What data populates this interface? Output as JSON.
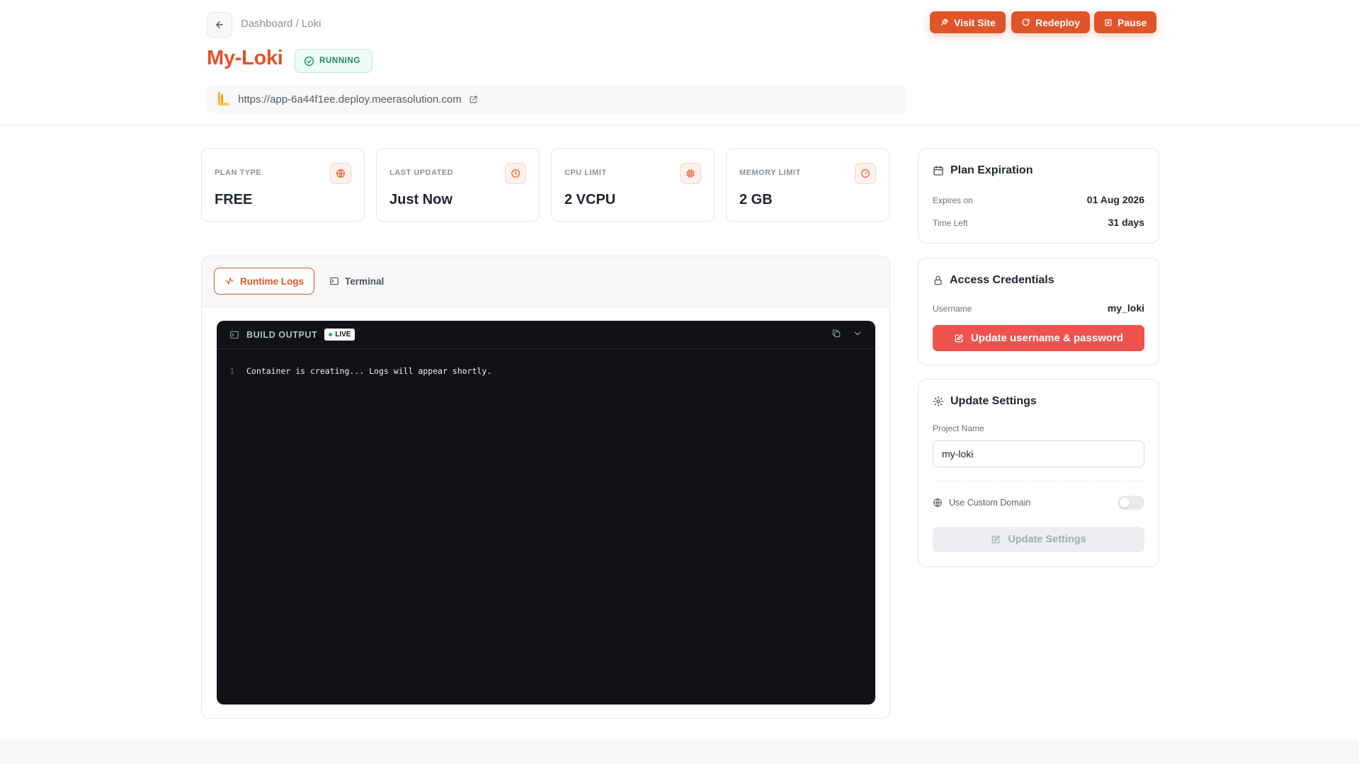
{
  "header": {
    "breadcrumb": "Dashboard / Loki",
    "title": "My-Loki",
    "status": "RUNNING",
    "url": "https://app-6a44f1ee.deploy.meerasolution.com",
    "actions": {
      "visit": "Visit Site",
      "redeploy": "Redeploy",
      "pause": "Pause"
    }
  },
  "stats": [
    {
      "label": "PLAN TYPE",
      "value": "FREE",
      "icon": "globe-icon"
    },
    {
      "label": "LAST UPDATED",
      "value": "Just Now",
      "icon": "clock-icon"
    },
    {
      "label": "CPU LIMIT",
      "value": "2 VCPU",
      "icon": "cpu-icon"
    },
    {
      "label": "MEMORY LIMIT",
      "value": "2 GB",
      "icon": "gauge-icon"
    }
  ],
  "logs": {
    "tabs": [
      {
        "label": "Runtime Logs",
        "active": true
      },
      {
        "label": "Terminal",
        "active": false
      }
    ],
    "panel_title": "BUILD OUTPUT",
    "live_label": "LIVE",
    "lines": [
      {
        "no": "1",
        "text": "Container is creating... Logs will appear shortly."
      }
    ]
  },
  "plan_expiration": {
    "title": "Plan Expiration",
    "expires_label": "Expires on",
    "expires_value": "01 Aug 2026",
    "left_label": "Time Left",
    "left_value": "31 days"
  },
  "credentials": {
    "title": "Access Credentials",
    "username_label": "Username",
    "username_value": "my_loki",
    "update_button": "Update username & password"
  },
  "settings": {
    "title": "Update Settings",
    "project_label": "Project Name",
    "project_value": "my-loki",
    "custom_domain_label": "Use Custom Domain",
    "custom_domain_on": false,
    "update_button": "Update Settings"
  },
  "colors": {
    "accent": "#e0542a",
    "danger": "#f0524e",
    "success": "#1f8a5a",
    "terminal_bg": "#101217"
  }
}
